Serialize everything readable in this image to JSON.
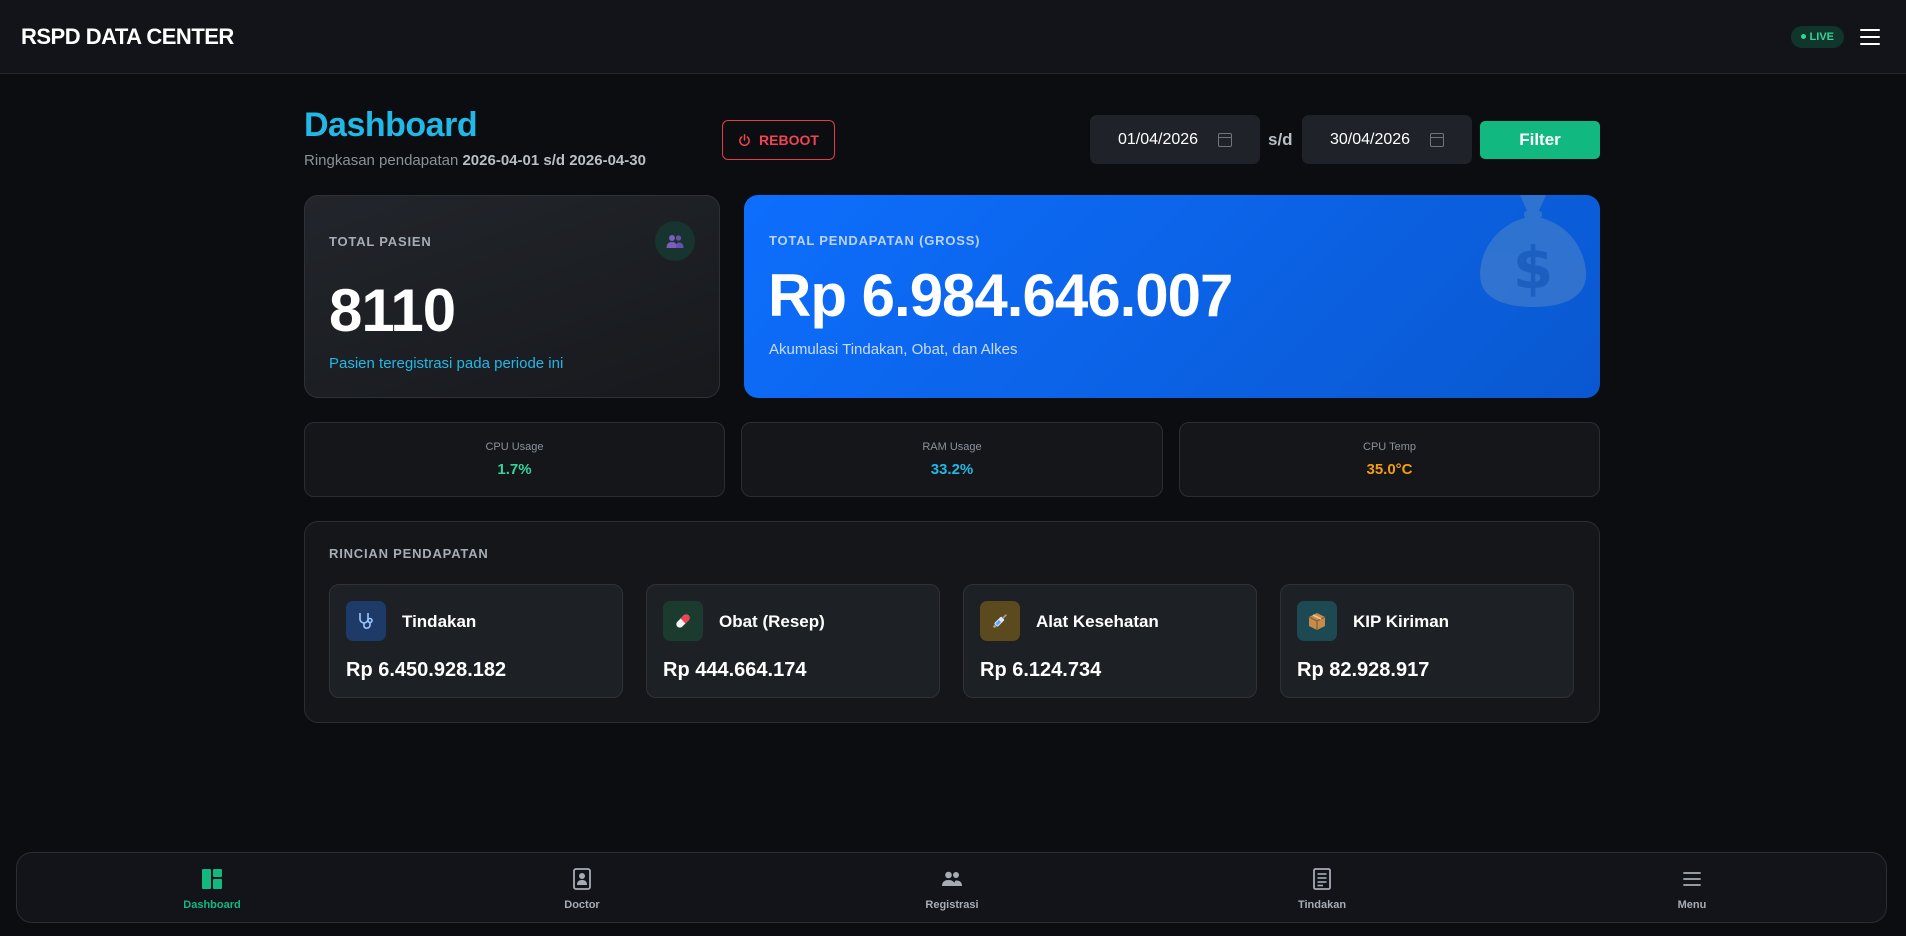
{
  "header": {
    "brand": "RSPD DATA CENTER",
    "live_label": "LIVE"
  },
  "page": {
    "title": "Dashboard",
    "subtitle_prefix": "Ringkasan pendapatan",
    "date_range": "2026-04-01 s/d 2026-04-30"
  },
  "toolbar": {
    "reboot_label": "REBOOT",
    "date_from": "01/04/2026",
    "date_to": "30/04/2026",
    "range_separator": "s/d",
    "filter_label": "Filter"
  },
  "total_pasien": {
    "label": "TOTAL PASIEN",
    "value": "8110",
    "note": "Pasien teregistrasi pada periode ini"
  },
  "total_gross": {
    "label": "TOTAL PENDAPATAN (GROSS)",
    "value": "Rp 6.984.646.007",
    "note": "Akumulasi Tindakan, Obat, dan Alkes"
  },
  "stats": [
    {
      "label": "CPU Usage",
      "value": "1.7%",
      "color": "#34d399"
    },
    {
      "label": "RAM Usage",
      "value": "33.2%",
      "color": "#22b8e6"
    },
    {
      "label": "CPU Temp",
      "value": "35.0°C",
      "color": "#f59e0b"
    }
  ],
  "rincian": {
    "title": "RINCIAN PENDAPATAN",
    "items": [
      {
        "label": "Tindakan",
        "value": "Rp 6.450.928.182",
        "icon": "stethoscope-icon",
        "icon_bg": "#1e3a68"
      },
      {
        "label": "Obat (Resep)",
        "value": "Rp 444.664.174",
        "icon": "pill-icon",
        "icon_bg": "#1b3b2e"
      },
      {
        "label": "Alat Kesehatan",
        "value": "Rp 6.124.734",
        "icon": "syringe-icon",
        "icon_bg": "#5b4a1d"
      },
      {
        "label": "KIP Kiriman",
        "value": "Rp 82.928.917",
        "icon": "package-icon",
        "icon_bg": "#1d4a52"
      }
    ]
  },
  "nav": [
    {
      "label": "Dashboard",
      "icon": "dashboard-icon",
      "active": true
    },
    {
      "label": "Doctor",
      "icon": "doctor-icon",
      "active": false
    },
    {
      "label": "Registrasi",
      "icon": "users-icon",
      "active": false
    },
    {
      "label": "Tindakan",
      "icon": "document-icon",
      "active": false
    },
    {
      "label": "Menu",
      "icon": "menu-icon",
      "active": false
    }
  ]
}
